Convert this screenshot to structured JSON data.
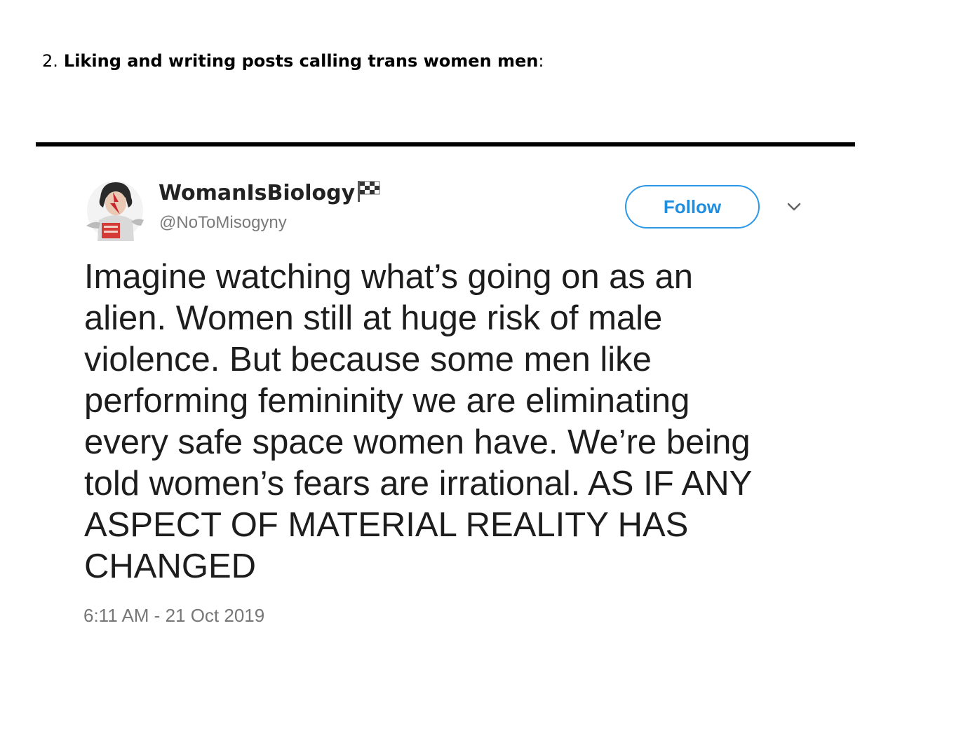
{
  "section_heading": {
    "number": "2.",
    "title": "Liking and writing posts calling trans women men",
    "suffix": ":"
  },
  "tweet": {
    "author": {
      "display_name": "WomanIsBiology",
      "handle": "@NoToMisogyny",
      "badge_icon": "checkered-flag-icon",
      "avatar_icon": "profile-avatar"
    },
    "follow_label": "Follow",
    "menu_icon": "chevron-down-icon",
    "text_lines": [
      "Imagine watching what’s going on as an",
      "alien. Women still at huge risk of male",
      "violence. But because some men like",
      "performing femininity we are eliminating",
      "every safe space women have. We’re being",
      "told women’s fears are irrational. AS IF ANY",
      "ASPECT OF MATERIAL REALITY HAS",
      "CHANGED"
    ],
    "timestamp": "6:11 AM - 21 Oct 2019"
  },
  "colors": {
    "accent": "#1f8de0",
    "handle_gray": "#7a7a7a",
    "rule": "#000000"
  }
}
